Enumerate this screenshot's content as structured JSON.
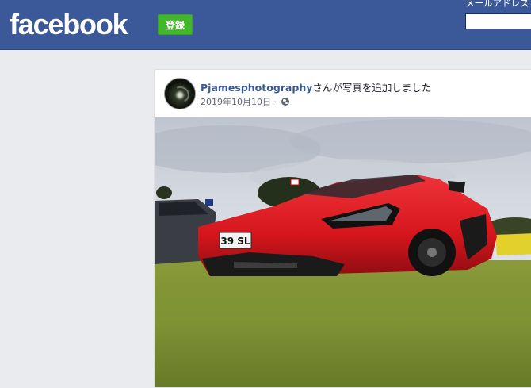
{
  "header": {
    "logo": "facebook",
    "signup_label": "登録",
    "email_label": "メールアドレス"
  },
  "post": {
    "author": "Pjamesphotography",
    "action": "さんが写真を追加しました",
    "date": "2019年10月10日",
    "separator": "·",
    "privacy_icon": "globe-icon",
    "photo": {
      "subject": "red sports car",
      "plate": "39 SL"
    }
  },
  "colors": {
    "brand_blue": "#3b5998",
    "signup_green": "#42b72a",
    "author_link": "#385898",
    "page_bg": "#e9ebee"
  }
}
